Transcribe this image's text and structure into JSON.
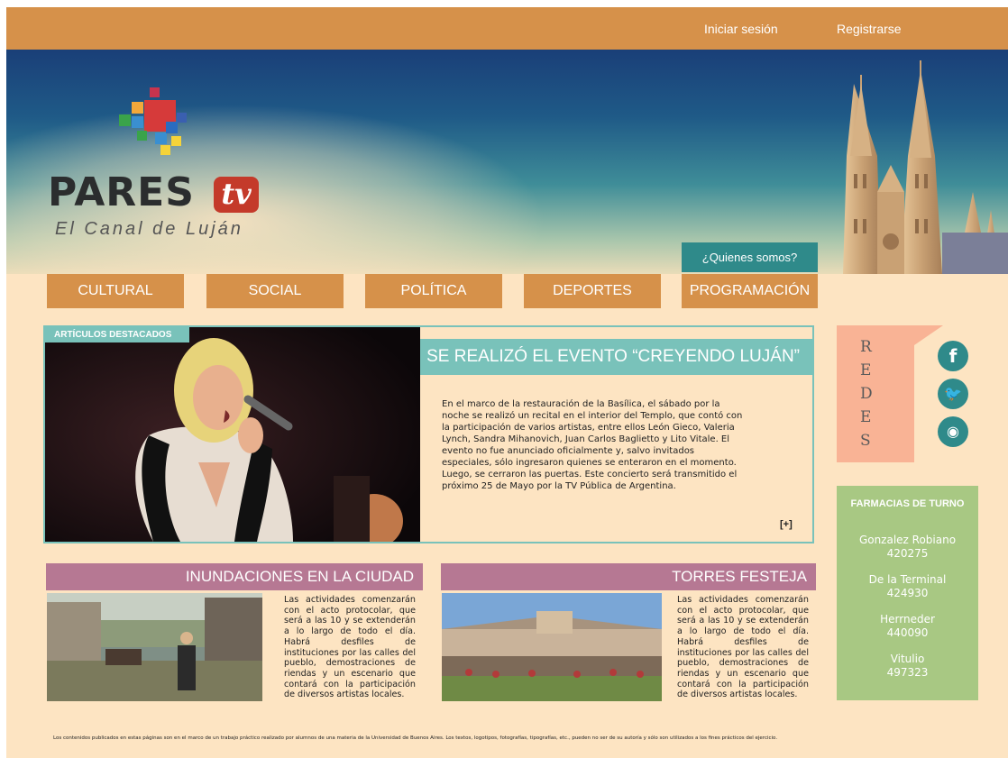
{
  "topbar": {
    "login": "Iniciar sesión",
    "register": "Registrarse"
  },
  "logo": {
    "name": "PARES",
    "tv": "tv",
    "tagline": "El Canal de Luján"
  },
  "hero": {
    "about_link": "¿Quienes somos?"
  },
  "nav": [
    "CULTURAL",
    "SOCIAL",
    "POLÍTICA",
    "DEPORTES",
    "PROGRAMACIÓN"
  ],
  "featured": {
    "tag": "ARTÍCULOS DESTACADOS",
    "title": "SE REALIZÓ EL EVENTO “CREYENDO LUJÁN”",
    "body": "En el marco de la restauración de la Basílica, el sábado por la noche se realizó un recital en el interior del Templo, que contó con la participación de varios artistas, entre ellos León Gieco, Valeria Lynch, Sandra Mihanovich, Juan Carlos Baglietto y Lito Vitale. El evento no fue anunciado oficialmente y, salvo invitados especiales, sólo ingresaron quienes se enteraron en el momento. Luego, se cerraron las puertas. Este concierto será transmitido el próximo 25 de Mayo por la TV Pública de Argentina.",
    "more": "[+]"
  },
  "redes": {
    "letters": [
      "R",
      "E",
      "D",
      "E",
      "S"
    ],
    "icons": [
      "facebook-icon",
      "twitter-icon",
      "rss-icon"
    ]
  },
  "pharmacies": {
    "title": "FARMACIAS DE TURNO",
    "items": [
      {
        "name": "Gonzalez Robiano",
        "phone": "420275"
      },
      {
        "name": "De la Terminal",
        "phone": "424930"
      },
      {
        "name": "Herrneder",
        "phone": "440090"
      },
      {
        "name": "Vitulio",
        "phone": "497323"
      }
    ]
  },
  "articles": [
    {
      "title": "INUNDACIONES EN LA CIUDAD",
      "body": "Las actividades comenzarán con el acto protocolar, que será a las 10 y se extenderán a lo largo de todo el día. Habrá desfiles de instituciones por las calles del pueblo, demostraciones de riendas y un escenario que contará con la participación de diversos artistas locales."
    },
    {
      "title": "TORRES FESTEJA",
      "body": "Las actividades comenzarán con el acto protocolar, que será a las 10 y se extenderán a lo largo de todo el día. Habrá desfiles de instituciones por las calles del pueblo, demostraciones de riendas y un escenario que contará con la participación de diversos artistas locales."
    }
  ],
  "footer": "Los contenidos publicados en estas páginas son en el marco de un trabajo práctico realizado por alumnos de una materia de la Universidad de Buenos Aires. Los textos, logotipos, fotografías, tipografías, etc., pueden no ser de su autoría y sólo son utilizados a los fines prácticos del ejercicio.",
  "colors": {
    "orange": "#d6914a",
    "teal": "#79c2ba",
    "dark_teal": "#2f8a8a",
    "purple": "#b67893",
    "green": "#a8c883",
    "salmon": "#f9b395",
    "cream": "#fde4c2"
  }
}
